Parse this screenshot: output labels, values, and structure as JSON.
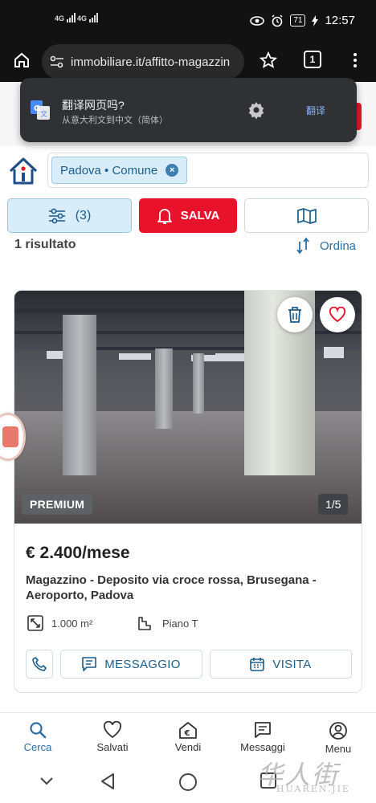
{
  "status_bar": {
    "signal_1": "4G",
    "signal_2": "4G",
    "battery": "71",
    "time": "12:57"
  },
  "browser": {
    "url": "immobiliare.it/affitto-magazzin",
    "tab_count": "1"
  },
  "translate_popup": {
    "title": "翻译网页吗?",
    "subtitle": "从意大利文到中文（简体）",
    "translate_button": "翻译"
  },
  "search": {
    "chip_label": "Padova • Comune"
  },
  "actions": {
    "filter_count": "(3)",
    "save_label": "SALVA"
  },
  "results": {
    "count_text": "1 risultato",
    "sort_label": "Ordina"
  },
  "listing": {
    "badge": "PREMIUM",
    "photo_counter": "1/5",
    "price": "€ 2.400/mese",
    "title": "Magazzino - Deposito via croce rossa, Brusegana - Aeroporto, Padova",
    "area": "1.000 m²",
    "floor": "Piano T",
    "message_label": "MESSAGGIO",
    "visit_label": "VISITA"
  },
  "bottom_nav": {
    "items": [
      {
        "label": "Cerca",
        "icon": "search-icon",
        "active": true
      },
      {
        "label": "Salvati",
        "icon": "heart-icon",
        "active": false
      },
      {
        "label": "Vendi",
        "icon": "euro-house-icon",
        "active": false
      },
      {
        "label": "Messaggi",
        "icon": "message-icon",
        "active": false
      },
      {
        "label": "Menu",
        "icon": "user-icon",
        "active": false
      }
    ]
  },
  "watermark": {
    "cn": "华人街",
    "en": "HUAREN.JIE"
  },
  "colors": {
    "accent_blue": "#2b6fa8",
    "brand_red": "#e8132b",
    "chip_bg": "#d8edf9"
  }
}
